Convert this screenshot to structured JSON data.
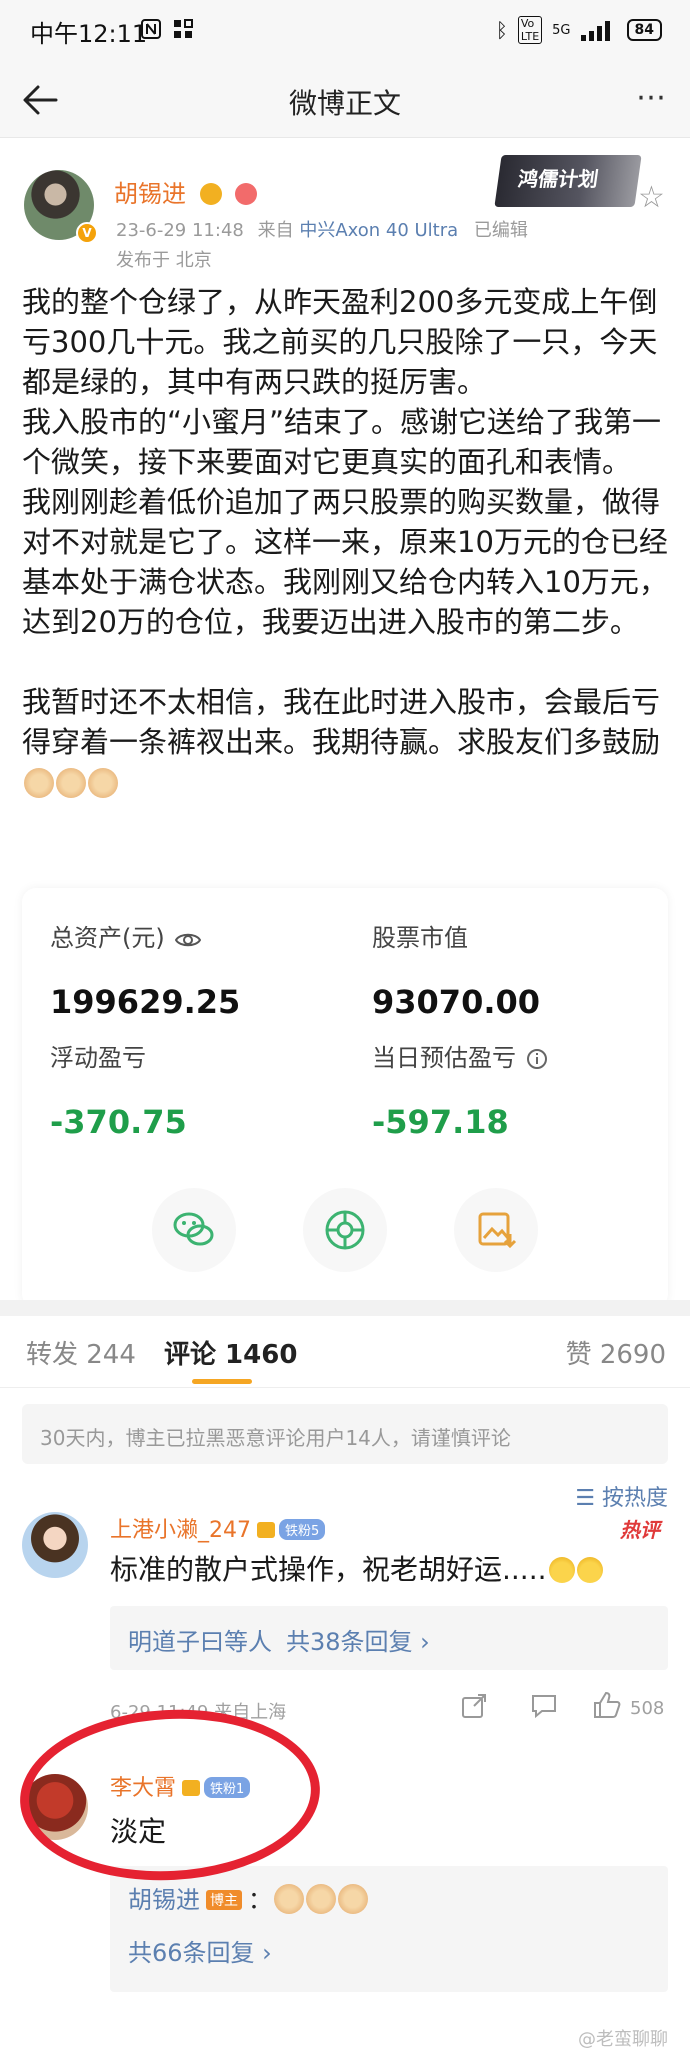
{
  "status_bar": {
    "time": "中午12:11",
    "battery": "84",
    "signal": "5G"
  },
  "nav": {
    "title": "微博正文"
  },
  "post": {
    "author_name": "胡锡进",
    "timestamp": "23-6-29 11:48",
    "source_prefix": "来自",
    "device": "中兴Axon 40 Ultra",
    "edited": "已编辑",
    "location": "发布于 北京",
    "banner_text": "鸿儒计划",
    "paragraphs": [
      "我的整个仓绿了，从昨天盈利200多元变成上午倒亏300几十元。我之前买的几只股除了一只，今天都是绿的，其中有两只跌的挺厉害。",
      "我入股市的“小蜜月”结束了。感谢它送给了我第一个微笑，接下来要面对它更真实的面孔和表情。",
      "我刚刚趁着低价追加了两只股票的购买数量，做得对不对就是它了。这样一来，原来10万元的仓已经基本处于满仓状态。我刚刚又给仓内转入10万元，达到20万的仓位，我要迈出进入股市的第二步。",
      "",
      "我暂时还不太相信，我在此时进入股市，会最后亏得穿着一条裤衩出来。我期待赢。求股友们多鼓励"
    ]
  },
  "portfolio": {
    "total_assets_label": "总资产(元)",
    "total_assets_value": "199629.25",
    "market_value_label": "股票市值",
    "market_value_value": "93070.00",
    "floating_pl_label": "浮动盈亏",
    "floating_pl_value": "-370.75",
    "daily_pl_label": "当日预估盈亏",
    "daily_pl_value": "-597.18",
    "negative_color": "#1f9e4a"
  },
  "tabs": {
    "repost": "转发 244",
    "comment": "评论 1460",
    "like": "赞 2690"
  },
  "notice": "30天内，博主已拉黑恶意评论用户14人，请谨慎评论",
  "sort_label": "按热度",
  "comments": [
    {
      "name": "上港小濑_247",
      "fan_badge": "铁粉5",
      "text": "标准的散户式操作，祝老胡好运.....",
      "hot": "热评",
      "reply_summary_names": "明道子曰等人",
      "reply_summary_count": "共38条回复 ›",
      "footer_time": "6-29 11:49 来自上海",
      "likes": "508"
    },
    {
      "name": "李大霄",
      "fan_badge": "铁粉1",
      "text": "淡定",
      "reply_author": "胡锡进",
      "reply_author_tag": "博主",
      "reply_colon": "：",
      "reply_count": "共66条回复 ›"
    }
  ],
  "watermark": "@老蛮聊聊",
  "colors": {
    "accent_orange": "#e9742a",
    "link_blue": "#5b7fb0",
    "tab_underline": "#f5a623",
    "annotation_red": "#e52231"
  }
}
